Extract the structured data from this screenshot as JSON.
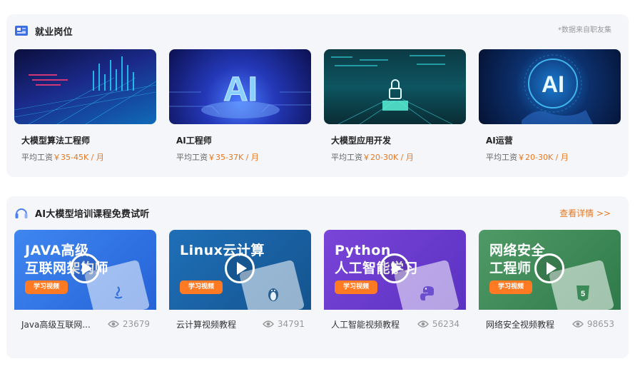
{
  "jobs_section": {
    "title": "就业岗位",
    "source_note": "*数据来自职友集",
    "salary_prefix": "平均工资",
    "jobs": [
      {
        "title": "大模型算法工程师",
        "salary": "￥35-45K / 月"
      },
      {
        "title": "AI工程师",
        "salary": "￥35-37K / 月"
      },
      {
        "title": "大模型应用开发",
        "salary": "￥20-30K / 月"
      },
      {
        "title": "AI运营",
        "salary": "￥20-30K / 月"
      }
    ]
  },
  "courses_section": {
    "title": "AI大模型培训课程免费试听",
    "more_link": "查看详情 >>",
    "courses": [
      {
        "banner_line1": "JAVA高级",
        "banner_line2": "互联网架构师",
        "tag": "学习视频",
        "name": "Java高级互联网...",
        "views": "23679",
        "logo_icon": "java-icon"
      },
      {
        "banner_line1": "Linux云计算",
        "banner_line2": "",
        "tag": "学习视频",
        "name": "云计算视频教程",
        "views": "34791",
        "logo_icon": "linux-penguin-icon"
      },
      {
        "banner_line1": "Python",
        "banner_line2": "人工智能学习",
        "tag": "学习视频",
        "name": "人工智能视频教程",
        "views": "56234",
        "logo_icon": "python-icon"
      },
      {
        "banner_line1": "网络安全",
        "banner_line2": "工程师",
        "tag": "学习视频",
        "name": "网络安全视频教程",
        "views": "98653",
        "logo_icon": "html5-shield-icon"
      }
    ]
  },
  "colors": {
    "accent_orange": "#e7771f",
    "panel_bg": "#f5f6fa",
    "banner_blue": "#2f7be8",
    "banner_teal": "#1a68a8",
    "banner_purple": "#6b3fd0",
    "banner_green": "#3f8a57"
  }
}
